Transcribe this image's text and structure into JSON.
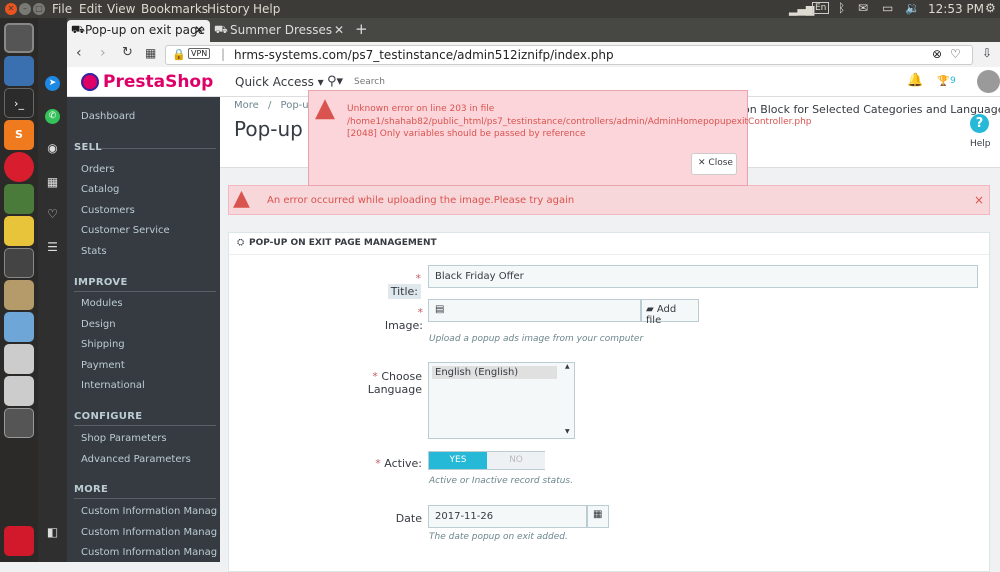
{
  "os": {
    "menu": [
      "File",
      "Edit",
      "View",
      "Bookmarks",
      "History",
      "Help"
    ],
    "clock": "12:53 PM",
    "lang": "En"
  },
  "browser": {
    "tabs": [
      {
        "label": "Pop-up on exit page"
      },
      {
        "label": "Summer Dresses"
      }
    ],
    "vpn": "VPN",
    "url": "hrms-systems.com/ps7_testinstance/admin512iznifp/index.php"
  },
  "presta": {
    "logo": "PrestaShop",
    "quick_access": "Quick Access",
    "search_placeholder": "Search",
    "notif_count": "9",
    "help": "Help"
  },
  "sidebar": {
    "dashboard": "Dashboard",
    "sell": {
      "title": "SELL",
      "items": [
        "Orders",
        "Catalog",
        "Customers",
        "Customer Service",
        "Stats"
      ]
    },
    "improve": {
      "title": "IMPROVE",
      "items": [
        "Modules",
        "Design",
        "Shipping",
        "Payment",
        "International"
      ]
    },
    "configure": {
      "title": "CONFIGURE",
      "items": [
        "Shop Parameters",
        "Advanced Parameters"
      ]
    },
    "more": {
      "title": "MORE",
      "items": [
        "Custom Information Managment",
        "Custom Information Managment",
        "Custom Information Managem..."
      ]
    }
  },
  "page": {
    "breadcrumb_more": "More",
    "breadcrumb_sep": "/",
    "breadcrumb_current": "Pop-up",
    "title": "Pop-up",
    "header_right": "on Block for Selected Categories and Languages"
  },
  "error_modal": {
    "line1": "Unknown error on line 203 in file",
    "line2": "/home1/shahab82/public_html/ps7_testinstance/controllers/admin/AdminHomepopupexitController.php",
    "line3": "[2048] Only variables should be passed by reference",
    "close": "Close"
  },
  "alert": {
    "text": "An error occurred while uploading the image.Please try again",
    "close": "×"
  },
  "panel": {
    "heading": "POP-UP ON EXIT PAGE MANAGEMENT",
    "required_mark": "*",
    "title_label": "Title:",
    "title_value": "Black Friday Offer",
    "image_label": "Image:",
    "add_file": "Add file",
    "image_help": "Upload a popup ads image from your computer",
    "language_label": "Choose Language",
    "language_option": "English (English)",
    "active_label": "Active:",
    "yes": "YES",
    "no": "NO",
    "active_help": "Active or Inactive record status.",
    "date_label": "Date",
    "date_value": "2017-11-26",
    "date_help": "The date popup on exit added."
  },
  "colors": {
    "accent": "#25b9d7",
    "sidebar": "#363a41",
    "error_bg": "#fbd5da",
    "error_text": "#d9534f"
  }
}
